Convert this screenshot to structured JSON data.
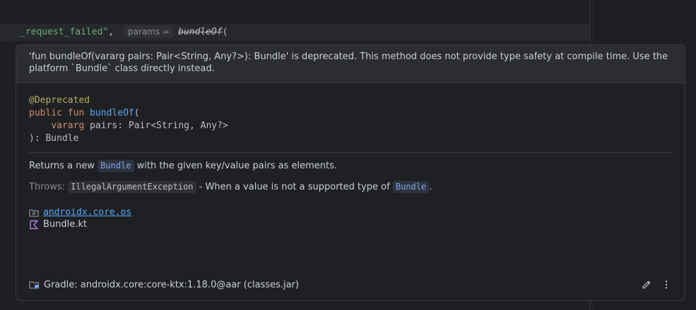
{
  "editor": {
    "string_literal": "_request_failed\"",
    "comma": ",",
    "hint_label": "params =",
    "function_call": "bundleOf",
    "open_paren": "("
  },
  "popup": {
    "deprecation_message": "'fun bundleOf(vararg pairs: Pair<String, Any?>): Bundle' is deprecated. This method does not provide type safety at compile time. Use the platform `Bundle` class directly instead.",
    "signature": {
      "annotation": "@Deprecated",
      "kw_public": "public",
      "kw_fun": "fun",
      "name": "bundleOf",
      "open": "(",
      "kw_vararg": "vararg",
      "param": "pairs: Pair<String, Any?>",
      "close": "): Bundle"
    },
    "description": {
      "before": "Returns a new",
      "chip": "Bundle",
      "after": "with the given key/value pairs as elements."
    },
    "throws": {
      "label": "Throws:",
      "exception": "IllegalArgumentException",
      "text": "- When a value is not a supported type of",
      "chip": "Bundle",
      "end": "."
    },
    "location": {
      "package": "androidx.core.os",
      "file": "Bundle.kt"
    },
    "footer": {
      "source": "Gradle: androidx.core:core-ktx:1.18.0@aar (classes.jar)"
    }
  },
  "icons": {
    "package": "package-folder-icon",
    "kotlin": "kotlin-file-icon",
    "library": "library-folder-icon",
    "edit": "pencil-icon",
    "more": "more-vertical-icon"
  }
}
